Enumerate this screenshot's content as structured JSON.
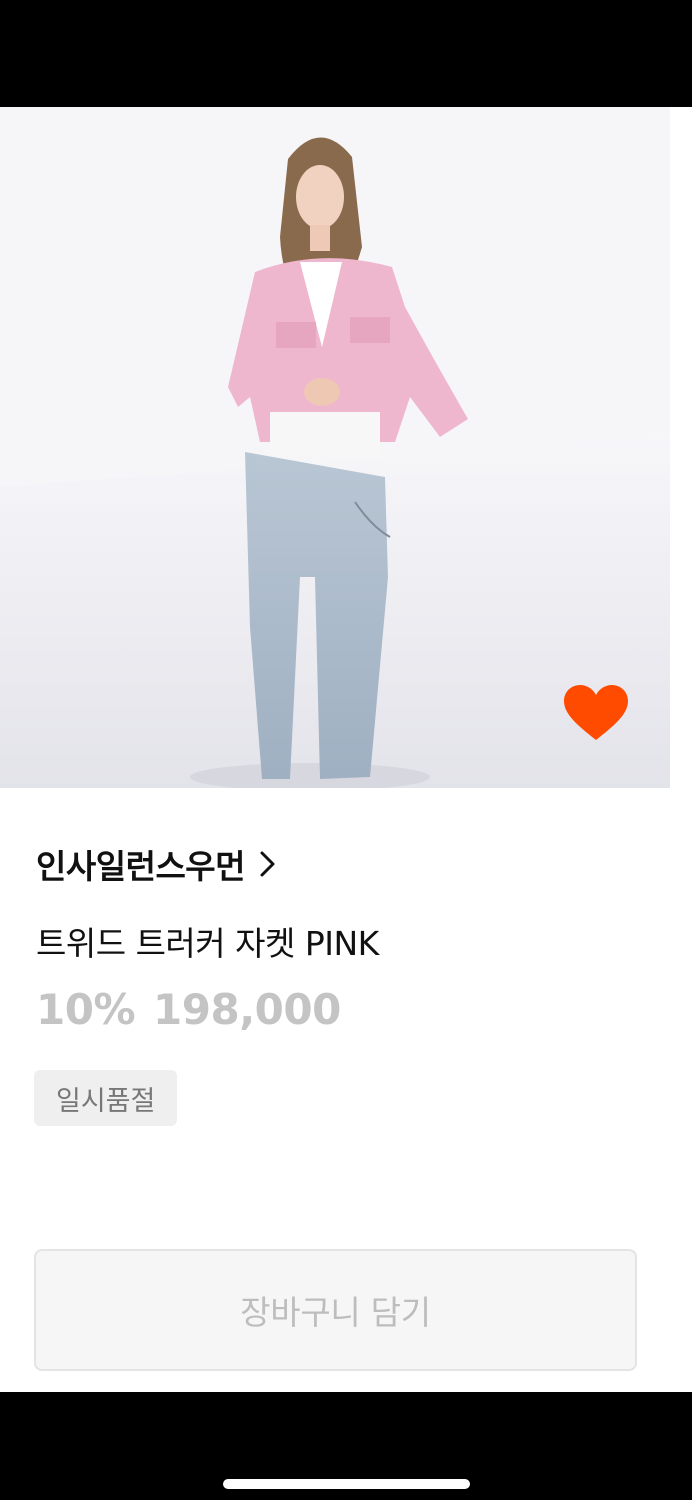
{
  "product": {
    "brand": "인사일런스우먼",
    "name": "트위드 트러커 자켓 PINK",
    "discount": "10%",
    "price": "198,000",
    "status_badge": "일시품절",
    "is_wishlisted": true
  },
  "actions": {
    "add_to_cart_label": "장바구니 담기"
  },
  "icons": {
    "wishlist": "heart-icon",
    "brand_link": "chevron-right-icon"
  },
  "colors": {
    "accent": "#ff4b00",
    "muted_text": "#c4c4c4",
    "badge_bg": "#efefef"
  }
}
